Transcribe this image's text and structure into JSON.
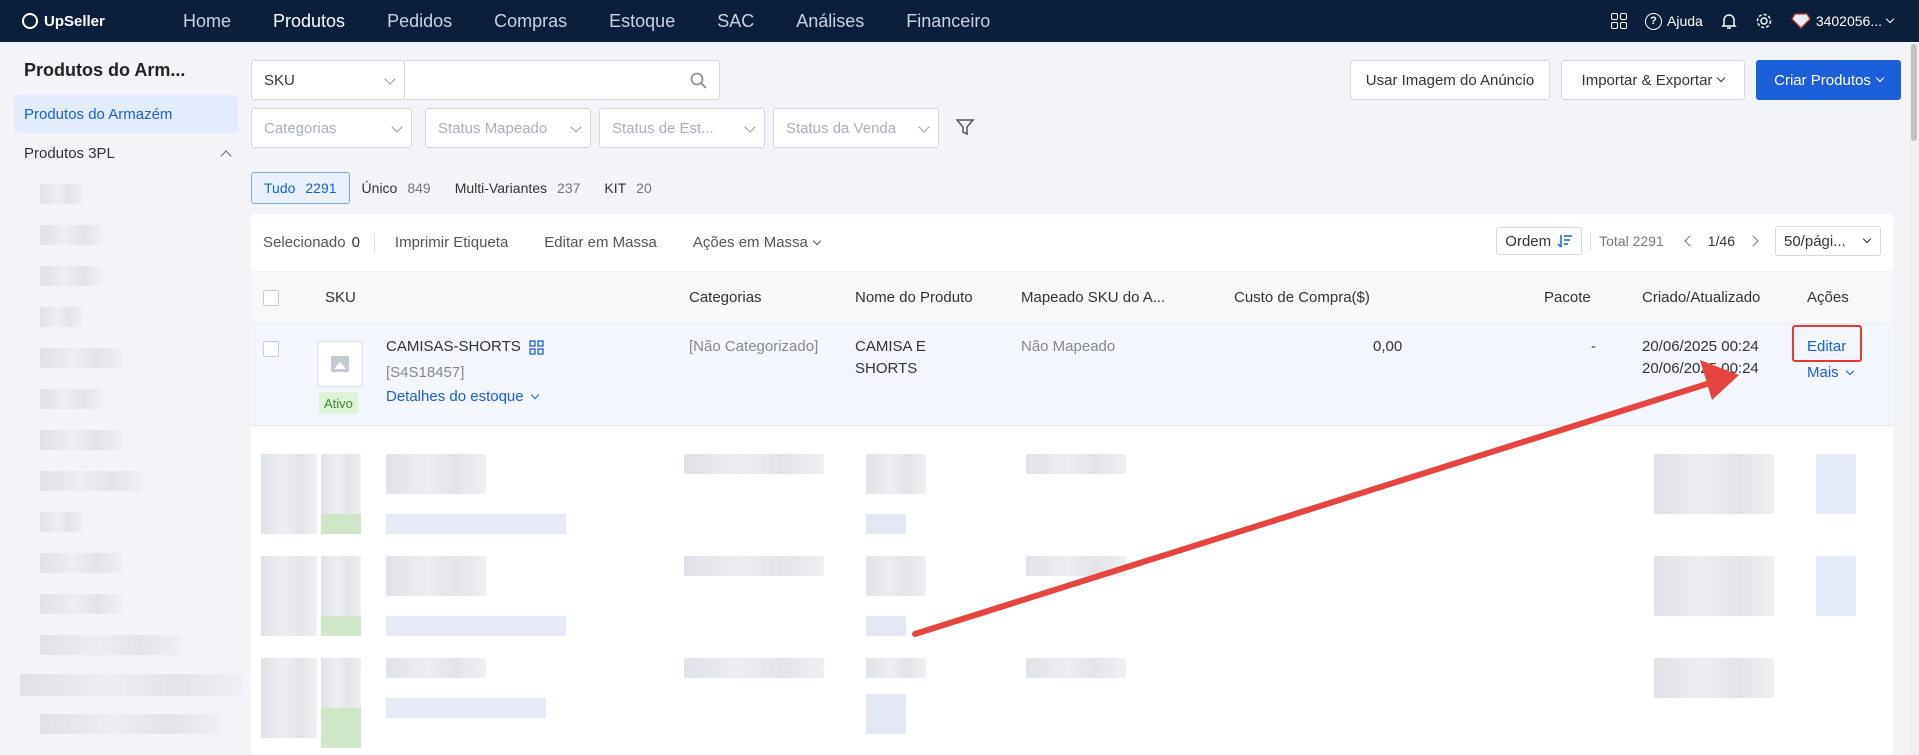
{
  "brand": {
    "name": "UpSeller"
  },
  "nav": {
    "items": [
      {
        "label": "Home",
        "active": false
      },
      {
        "label": "Produtos",
        "active": true
      },
      {
        "label": "Pedidos",
        "active": false
      },
      {
        "label": "Compras",
        "active": false
      },
      {
        "label": "Estoque",
        "active": false
      },
      {
        "label": "SAC",
        "active": false
      },
      {
        "label": "Análises",
        "active": false
      },
      {
        "label": "Financeiro",
        "active": false
      }
    ]
  },
  "topright": {
    "help": "Ajuda",
    "account": "3402056..."
  },
  "sidebar": {
    "title": "Produtos do Arm...",
    "active_item": "Produtos do Armazém",
    "section": "Produtos 3PL"
  },
  "filters": {
    "search_type": "SKU",
    "search_placeholder": "",
    "categorias": "Categorias",
    "status_mapeado": "Status Mapeado",
    "status_estoque": "Status de Est...",
    "status_venda": "Status da Venda"
  },
  "actions": {
    "usar_imagem": "Usar Imagem do Anúncio",
    "importar": "Importar & Exportar",
    "criar": "Criar Produtos"
  },
  "tabs": [
    {
      "label": "Tudo",
      "count": "2291",
      "active": true
    },
    {
      "label": "Único",
      "count": "849",
      "active": false
    },
    {
      "label": "Multi-Variantes",
      "count": "237",
      "active": false
    },
    {
      "label": "KIT",
      "count": "20",
      "active": false
    }
  ],
  "toolbar": {
    "selecionado_label": "Selecionado",
    "selecionado_count": "0",
    "imprimir": "Imprimir Etiqueta",
    "editar_massa": "Editar em Massa",
    "acoes_massa": "Ações em Massa",
    "ordem": "Ordem",
    "total": "Total 2291",
    "page": "1/46",
    "per_page": "50/pági..."
  },
  "table": {
    "headers": {
      "sku": "SKU",
      "categorias": "Categorias",
      "nome": "Nome do Produto",
      "mapeado": "Mapeado SKU do A...",
      "custo": "Custo de Compra($)",
      "pacote": "Pacote",
      "criado": "Criado/Atualizado",
      "acoes": "Ações"
    },
    "row": {
      "name": "CAMISAS-SHORTS",
      "sku": "[S4S18457]",
      "detalhes": "Detalhes do estoque",
      "status": "Ativo",
      "categoria": "[Não Categorizado]",
      "nome_line1": "CAMISA E",
      "nome_line2": "SHORTS",
      "mapeado": "Não Mapeado",
      "custo": "0,00",
      "pacote": "-",
      "criado": "20/06/2025 00:24",
      "atualizado": "20/06/2025 00:24",
      "editar": "Editar",
      "mais": "Mais"
    }
  },
  "colors": {
    "primary": "#1a5ed8",
    "nav_bg": "#0b1e3a",
    "annotation": "#e53935"
  }
}
